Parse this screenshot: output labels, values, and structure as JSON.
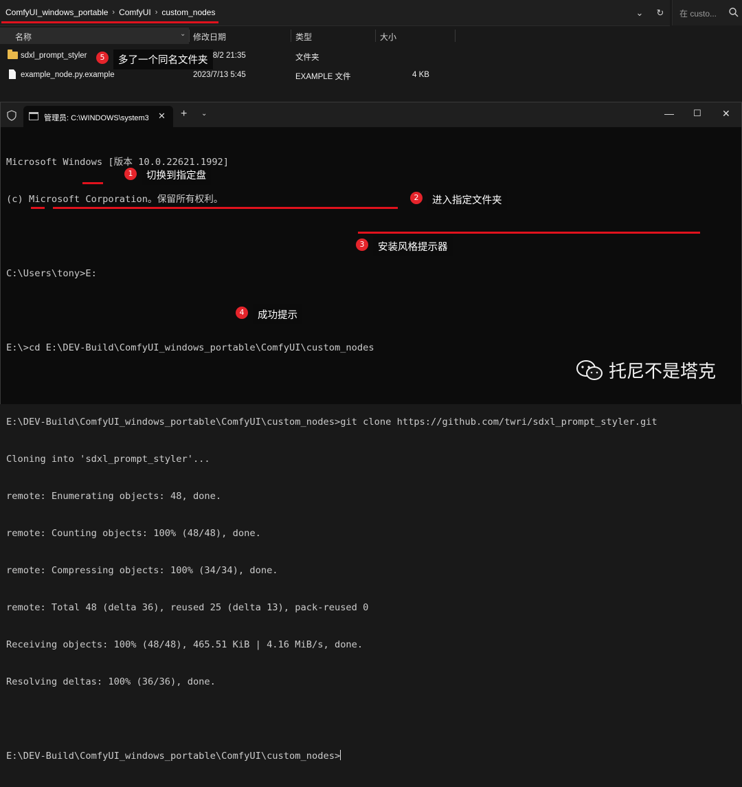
{
  "explorer": {
    "breadcrumb": [
      "ComfyUI_windows_portable",
      "ComfyUI",
      "custom_nodes"
    ],
    "search_placeholder": "在 custo...",
    "columns": {
      "name": "名称",
      "modified": "修改日期",
      "type": "类型",
      "size": "大小"
    },
    "files": [
      {
        "name": "sdxl_prompt_styler",
        "modified": "2023/8/2 21:35",
        "type": "文件夹",
        "size": "",
        "icon": "folder-icon"
      },
      {
        "name": "example_node.py.example",
        "modified": "2023/7/13 5:45",
        "type": "EXAMPLE 文件",
        "size": "4 KB",
        "icon": "file-icon"
      }
    ]
  },
  "terminal": {
    "tab_title": "管理员: C:\\WINDOWS\\system3",
    "lines": [
      "Microsoft Windows [版本 10.0.22621.1992]",
      "(c) Microsoft Corporation。保留所有权利。",
      "",
      "C:\\Users\\tony>E:",
      "",
      "E:\\>cd E:\\DEV-Build\\ComfyUI_windows_portable\\ComfyUI\\custom_nodes",
      "",
      "E:\\DEV-Build\\ComfyUI_windows_portable\\ComfyUI\\custom_nodes>git clone https://github.com/twri/sdxl_prompt_styler.git",
      "Cloning into 'sdxl_prompt_styler'...",
      "remote: Enumerating objects: 48, done.",
      "remote: Counting objects: 100% (48/48), done.",
      "remote: Compressing objects: 100% (34/34), done.",
      "remote: Total 48 (delta 36), reused 25 (delta 13), pack-reused 0",
      "Receiving objects: 100% (48/48), 465.51 KiB | 4.16 MiB/s, done.",
      "Resolving deltas: 100% (36/36), done.",
      "",
      "E:\\DEV-Build\\ComfyUI_windows_portable\\ComfyUI\\custom_nodes>"
    ]
  },
  "annotations": [
    {
      "num": "1",
      "text": "切换到指定盘"
    },
    {
      "num": "2",
      "text": "进入指定文件夹"
    },
    {
      "num": "3",
      "text": "安装风格提示器"
    },
    {
      "num": "4",
      "text": "成功提示"
    },
    {
      "num": "5",
      "text": "多了一个同名文件夹"
    }
  ],
  "watermark": "托尼不是塔克",
  "colors": {
    "accent_red": "#e0121d",
    "badge_red": "#e5242b",
    "folder": "#e8b84a",
    "terminal_bg": "#0c0c0c"
  }
}
